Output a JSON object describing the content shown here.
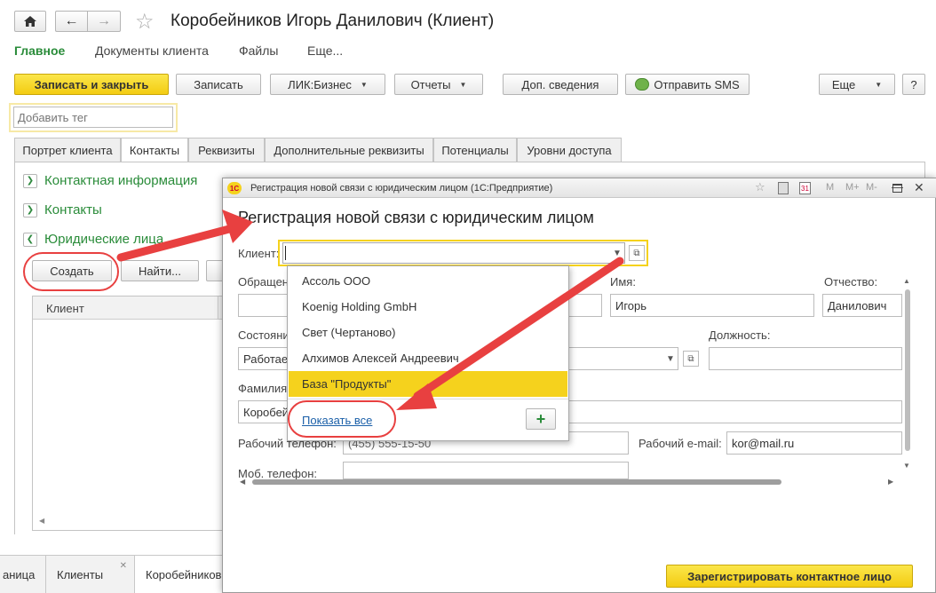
{
  "window": {
    "title": "Коробейников Игорь Данилович (Клиент)"
  },
  "nav": {
    "items": [
      "Главное",
      "Документы клиента",
      "Файлы",
      "Еще..."
    ]
  },
  "toolbar": {
    "save_close": "Записать и закрыть",
    "save": "Записать",
    "lik": "ЛИК:Бизнес",
    "reports": "Отчеты",
    "extra_info": "Доп. сведения",
    "send_sms": "Отправить SMS",
    "more": "Еще",
    "help": "?"
  },
  "tag_input": {
    "placeholder": "Добавить тег"
  },
  "tabs": [
    "Портрет клиента",
    "Контакты",
    "Реквизиты",
    "Дополнительные реквизиты",
    "Потенциалы",
    "Уровни доступа"
  ],
  "groups": {
    "contact_info": "Контактная информация",
    "contacts": "Контакты",
    "legal": "Юридические лица"
  },
  "legal_toolbar": {
    "create": "Создать",
    "find": "Найти..."
  },
  "legal_table": {
    "header": "Клиент"
  },
  "bottom_tabs": [
    "аница",
    "Клиенты",
    "Коробейников"
  ],
  "dialog": {
    "window_title": "Регистрация новой связи с юридическим лицом  (1С:Предприятие)",
    "heading": "Регистрация новой связи с юридическим лицом",
    "title_buttons": [
      "M",
      "M+",
      "M-"
    ],
    "client_label": "Клиент:",
    "client_value": "",
    "labels": {
      "address": "Обращен",
      "name": "Имя:",
      "patronymic": "Отчество:",
      "state": "Состояни",
      "position": "Должность:",
      "surname": "Фамилия",
      "work_phone": "Рабочий телефон:",
      "work_email": "Рабочий e-mail:",
      "mobile": "Моб. телефон:"
    },
    "values": {
      "name": "Игорь",
      "patronymic": "Данилович",
      "state": "Работае",
      "surname": "Коробей",
      "work_phone": "(455) 555-15-50",
      "work_email": "kor@mail.ru"
    },
    "register_button": "Зарегистрировать контактное лицо"
  },
  "dropdown": {
    "items": [
      "Ассоль ООО",
      "Koenig Holding GmbH",
      "Свет (Чертаново)",
      "Алхимов Алексей Андреевич",
      "База \"Продукты\""
    ],
    "selected_index": 4,
    "show_all": "Показать все",
    "add": "+"
  },
  "colors": {
    "accent_yellow": "#f5d21d",
    "green": "#2a8c3a",
    "red_annotation": "#e84040",
    "link_blue": "#1a5fa8"
  }
}
